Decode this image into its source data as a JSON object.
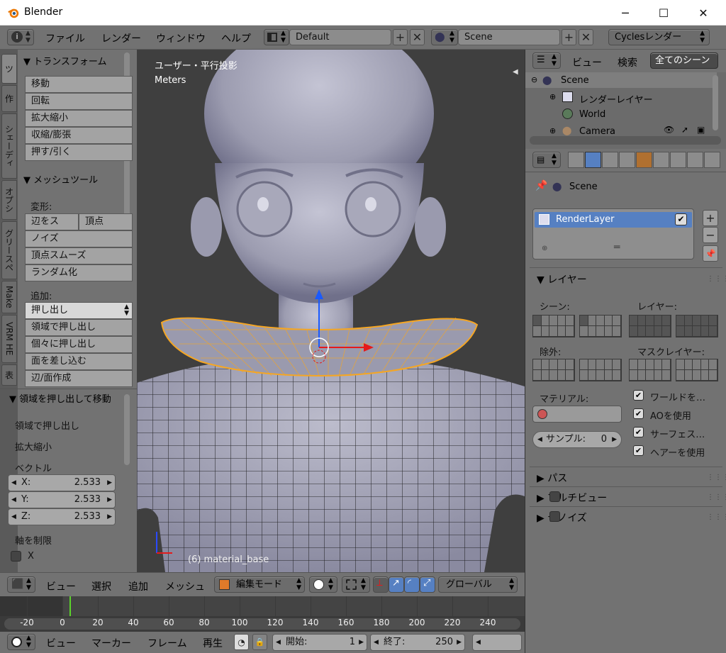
{
  "window": {
    "title": "Blender",
    "minimize": "─",
    "maximize": "☐",
    "close": "✕"
  },
  "info_header": {
    "menus": [
      "ファイル",
      "レンダー",
      "ウィンドウ",
      "ヘルプ"
    ],
    "layout": "Default",
    "scene": "Scene",
    "engine": "Cyclesレンダー"
  },
  "tool_tabs": [
    "ツ",
    "作",
    "シェーディ",
    "オプシ",
    "グリースペ",
    "Make",
    "VRM HE",
    "表"
  ],
  "toolshelf": {
    "transform_header": "▼ トランスフォーム",
    "transform_buttons": [
      "移動",
      "回転",
      "拡大縮小",
      "収縮/膨張",
      "押す/引く"
    ],
    "mesh_header": "▼ メッシュツール",
    "deform_label": "変形:",
    "deform_pair": [
      "辺をス",
      "頂点"
    ],
    "deform_buttons": [
      "ノイズ",
      "頂点スムーズ",
      "ランダム化"
    ],
    "add_label": "追加:",
    "extrude_select": "押し出し",
    "add_buttons": [
      "領域で押し出し",
      "個々に押し出し",
      "面を差し込む",
      "辺/面作成"
    ],
    "op_header": "▼ 領域を押し出して移動",
    "op_items": [
      "領域で押し出し",
      "拡大縮小"
    ],
    "vector_label": "ベクトル",
    "vector": [
      {
        "axis": "X:",
        "value": "2.533"
      },
      {
        "axis": "Y:",
        "value": "2.533"
      },
      {
        "axis": "Z:",
        "value": "2.533"
      }
    ],
    "constraint_label": "軸を制限",
    "constraint_x": "X"
  },
  "viewport": {
    "view_label": "ユーザー・平行投影",
    "units": "Meters",
    "object_label": "(6) material_base"
  },
  "view3d_header": {
    "menus": [
      "ビュー",
      "選択",
      "追加",
      "メッシュ"
    ],
    "mode": "編集モード",
    "orientation": "グローバル"
  },
  "timeline": {
    "ticks": [
      "-20",
      "0",
      "20",
      "40",
      "60",
      "80",
      "100",
      "120",
      "140",
      "160",
      "180",
      "200",
      "220",
      "240"
    ],
    "menus": [
      "ビュー",
      "マーカー",
      "フレーム",
      "再生"
    ],
    "start_label": "開始:",
    "start_value": "1",
    "end_label": "終了:",
    "end_value": "250"
  },
  "outliner": {
    "menus": [
      "ビュー",
      "検索"
    ],
    "filter": "全てのシーン",
    "items": [
      "Scene",
      "レンダーレイヤー",
      "World",
      "Camera"
    ]
  },
  "properties": {
    "context": "Scene",
    "render_layer": "RenderLayer",
    "layer_panel": "▼ レイヤー",
    "scene_label": "シーン:",
    "layer_label": "レイヤー:",
    "exclude_label": "除外:",
    "mask_label": "マスクレイヤー:",
    "material_label": "マテリアル:",
    "samples_label": "サンプル:",
    "samples_value": "0",
    "checks": [
      "ワールドを…",
      "AOを使用",
      "サーフェス…",
      "ヘアーを使用"
    ],
    "collapsed": [
      "▶ パス",
      "▶ マルチビュー",
      "▶ デノイズ"
    ]
  },
  "colors": {
    "selection": "#f5a623",
    "accent": "#5680c2"
  }
}
